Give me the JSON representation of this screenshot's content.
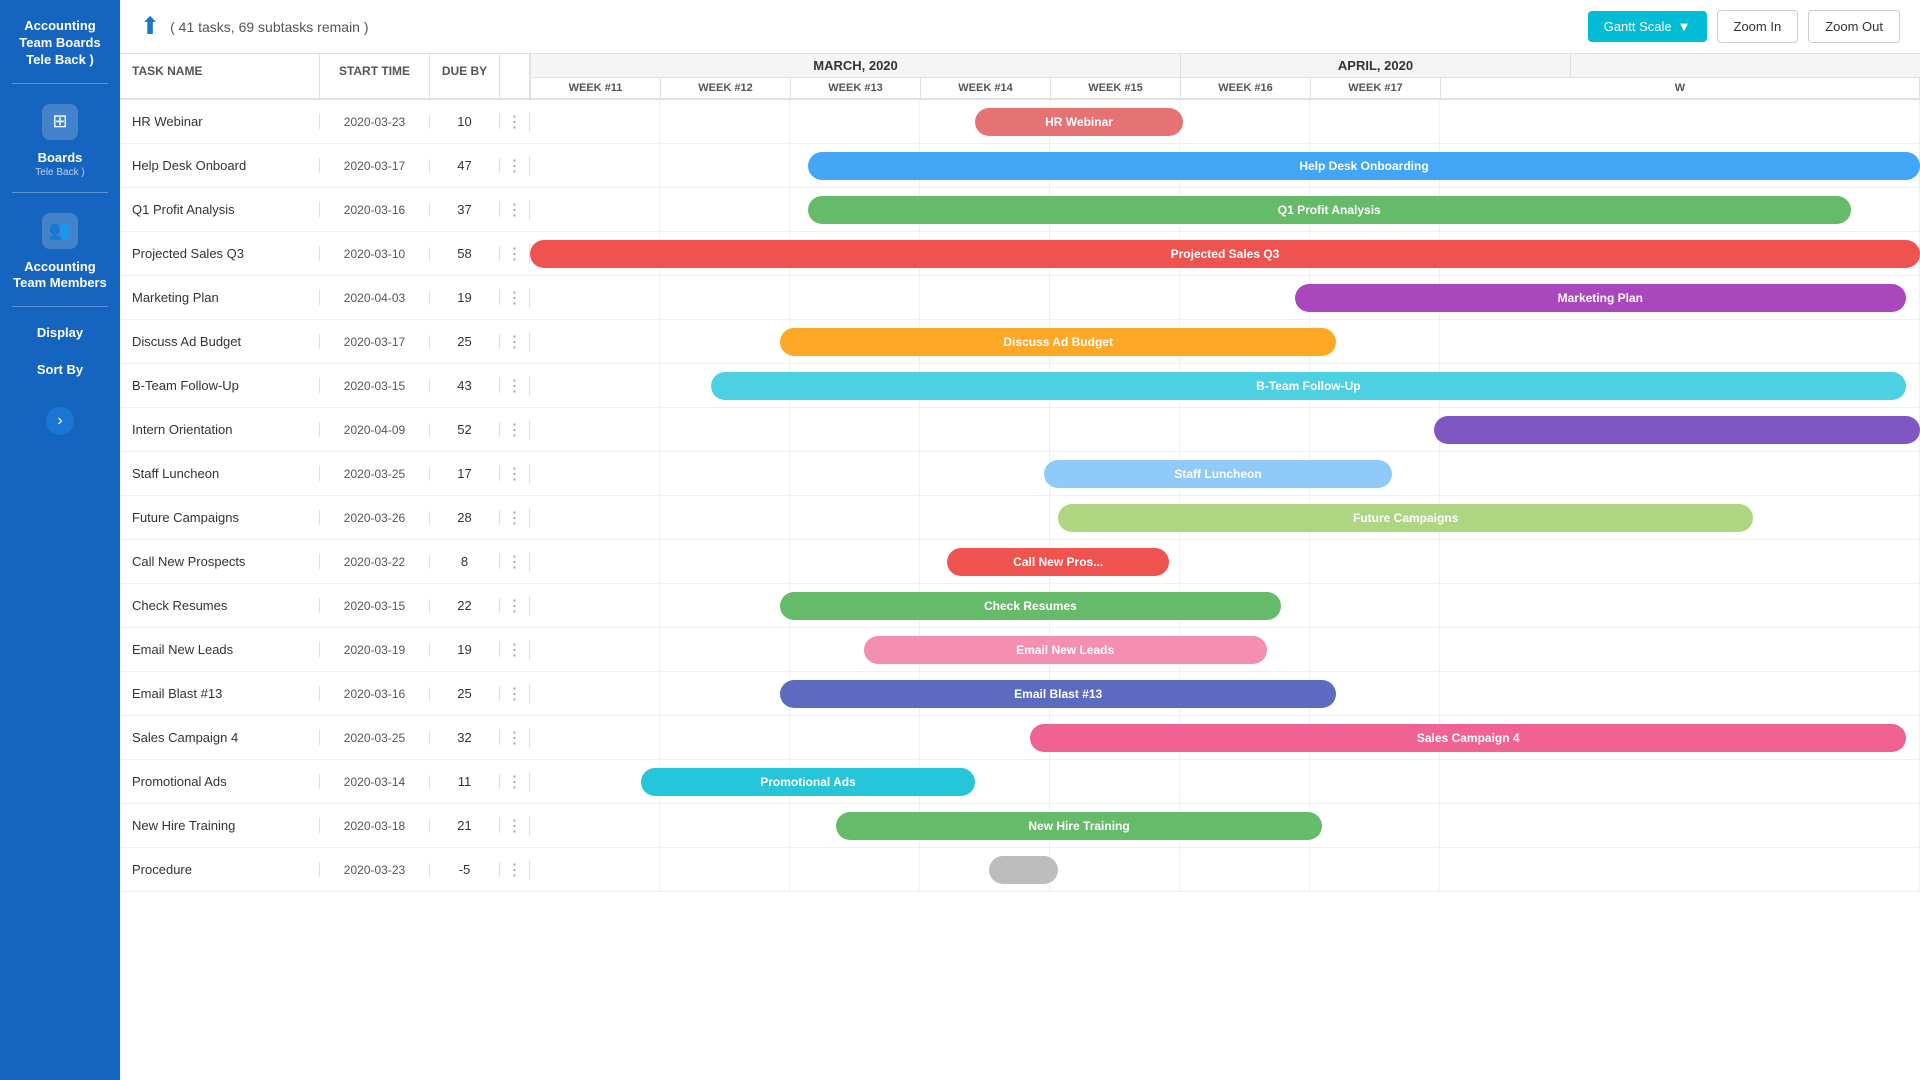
{
  "sidebar": {
    "title": "Accounting Team Boards Tele Back )",
    "boards_label": "Boards",
    "boards_sub": "Tele Back )",
    "members_label": "Accounting Team Members",
    "display_label": "Display",
    "sortby_label": "Sort By"
  },
  "topbar": {
    "task_summary": "( 41 tasks, 69 subtasks remain )",
    "gantt_scale_label": "Gantt Scale",
    "zoom_in_label": "Zoom In",
    "zoom_out_label": "Zoom Out"
  },
  "header_columns": {
    "task_name": "TASK NAME",
    "start_time": "START TIME",
    "due_by": "DUE BY"
  },
  "months": [
    {
      "label": "MARCH, 2020",
      "weeks": 5
    },
    {
      "label": "APRIL, 2020",
      "weeks": 3
    }
  ],
  "weeks": [
    "WEEK #11",
    "WEEK #12",
    "WEEK #13",
    "WEEK #14",
    "WEEK #15",
    "WEEK #16",
    "WEEK #17",
    "W"
  ],
  "tasks": [
    {
      "name": "HR Webinar",
      "start": "2020-03-23",
      "due": 10,
      "bar_label": "HR Webinar",
      "bar_color": "#e57373",
      "bar_left_pct": 32,
      "bar_width_pct": 15
    },
    {
      "name": "Help Desk Onboard",
      "start": "2020-03-17",
      "due": 47,
      "bar_label": "Help Desk Onboarding",
      "bar_color": "#42a5f5",
      "bar_left_pct": 20,
      "bar_width_pct": 80
    },
    {
      "name": "Q1 Profit Analysis",
      "start": "2020-03-16",
      "due": 37,
      "bar_label": "Q1 Profit Analysis",
      "bar_color": "#66bb6a",
      "bar_left_pct": 20,
      "bar_width_pct": 75
    },
    {
      "name": "Projected Sales Q3",
      "start": "2020-03-10",
      "due": 58,
      "bar_label": "Projected Sales Q3",
      "bar_color": "#ef5350",
      "bar_left_pct": 0,
      "bar_width_pct": 100
    },
    {
      "name": "Marketing Plan",
      "start": "2020-04-03",
      "due": 19,
      "bar_label": "Marketing Plan",
      "bar_color": "#ab47bc",
      "bar_left_pct": 55,
      "bar_width_pct": 44
    },
    {
      "name": "Discuss Ad Budget",
      "start": "2020-03-17",
      "due": 25,
      "bar_label": "Discuss Ad Budget",
      "bar_color": "#ffa726",
      "bar_left_pct": 18,
      "bar_width_pct": 40
    },
    {
      "name": "B-Team Follow-Up",
      "start": "2020-03-15",
      "due": 43,
      "bar_label": "B-Team Follow-Up",
      "bar_color": "#4dd0e1",
      "bar_left_pct": 13,
      "bar_width_pct": 86
    },
    {
      "name": "Intern Orientation",
      "start": "2020-04-09",
      "due": 52,
      "bar_label": "",
      "bar_color": "#7e57c2",
      "bar_left_pct": 65,
      "bar_width_pct": 35
    },
    {
      "name": "Staff Luncheon",
      "start": "2020-03-25",
      "due": 17,
      "bar_label": "Staff Luncheon",
      "bar_color": "#90caf9",
      "bar_left_pct": 37,
      "bar_width_pct": 25
    },
    {
      "name": "Future Campaigns",
      "start": "2020-03-26",
      "due": 28,
      "bar_label": "Future Campaigns",
      "bar_color": "#aed581",
      "bar_left_pct": 38,
      "bar_width_pct": 50
    },
    {
      "name": "Call New Prospects",
      "start": "2020-03-22",
      "due": 8,
      "bar_label": "Call New Pros...",
      "bar_color": "#ef5350",
      "bar_left_pct": 30,
      "bar_width_pct": 16
    },
    {
      "name": "Check Resumes",
      "start": "2020-03-15",
      "due": 22,
      "bar_label": "Check Resumes",
      "bar_color": "#66bb6a",
      "bar_left_pct": 18,
      "bar_width_pct": 36
    },
    {
      "name": "Email New Leads",
      "start": "2020-03-19",
      "due": 19,
      "bar_label": "Email New Leads",
      "bar_color": "#f48fb1",
      "bar_left_pct": 24,
      "bar_width_pct": 29
    },
    {
      "name": "Email Blast #13",
      "start": "2020-03-16",
      "due": 25,
      "bar_label": "Email Blast #13",
      "bar_color": "#5c6bc0",
      "bar_left_pct": 18,
      "bar_width_pct": 40
    },
    {
      "name": "Sales Campaign 4",
      "start": "2020-03-25",
      "due": 32,
      "bar_label": "Sales Campaign 4",
      "bar_color": "#f06292",
      "bar_left_pct": 36,
      "bar_width_pct": 63
    },
    {
      "name": "Promotional Ads",
      "start": "2020-03-14",
      "due": 11,
      "bar_label": "Promotional Ads",
      "bar_color": "#26c6da",
      "bar_left_pct": 8,
      "bar_width_pct": 24
    },
    {
      "name": "New Hire Training",
      "start": "2020-03-18",
      "due": 21,
      "bar_label": "New Hire Training",
      "bar_color": "#66bb6a",
      "bar_left_pct": 22,
      "bar_width_pct": 35
    },
    {
      "name": "Procedure",
      "start": "2020-03-23",
      "due": -5,
      "bar_label": "",
      "bar_color": "#bdbdbd",
      "bar_left_pct": 33,
      "bar_width_pct": 5
    }
  ]
}
